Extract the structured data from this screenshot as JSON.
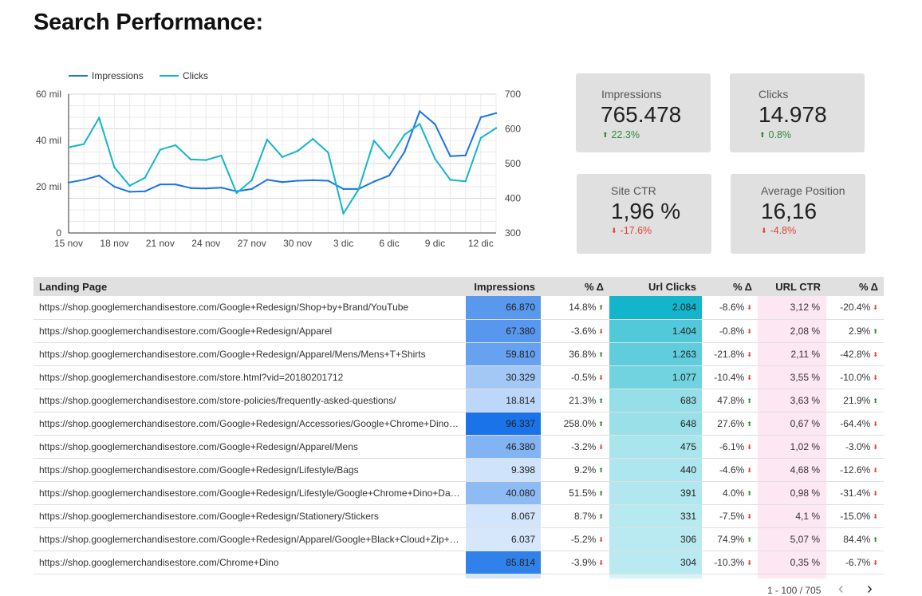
{
  "page": {
    "title": "Search Performance:"
  },
  "chart_data": {
    "type": "line",
    "x": [
      "15 nov",
      "16 nov",
      "17 nov",
      "18 nov",
      "19 nov",
      "20 nov",
      "21 nov",
      "22 nov",
      "23 nov",
      "24 nov",
      "25 nov",
      "26 nov",
      "27 nov",
      "28 nov",
      "29 nov",
      "30 nov",
      "1 dic",
      "2 dic",
      "3 dic",
      "4 dic",
      "5 dic",
      "6 dic",
      "7 dic",
      "8 dic",
      "9 dic",
      "10 dic",
      "11 dic",
      "12 dic",
      "13 dic"
    ],
    "x_ticks": [
      "15 nov",
      "18 nov",
      "21 nov",
      "24 nov",
      "27 nov",
      "30 nov",
      "3 dic",
      "6 dic",
      "9 dic",
      "12 dic"
    ],
    "series": [
      {
        "name": "Impressions",
        "axis": "left",
        "color": "#1a73e8",
        "values": [
          21800,
          23000,
          24800,
          20000,
          17800,
          18000,
          21000,
          21000,
          19400,
          19200,
          19600,
          18000,
          19000,
          23000,
          22000,
          22600,
          22800,
          22600,
          19000,
          19000,
          22200,
          24800,
          35000,
          52600,
          47000,
          33200,
          33500,
          50000,
          51800
        ]
      },
      {
        "name": "Clicks",
        "axis": "right",
        "color": "#12b5cb",
        "values": [
          547,
          556,
          632,
          489,
          436,
          459,
          540,
          553,
          512,
          510,
          523,
          415,
          452,
          569,
          519,
          536,
          571,
          532,
          356,
          426,
          566,
          515,
          583,
          614,
          514,
          453,
          449,
          574,
          602
        ]
      }
    ],
    "y_left": {
      "min": 0,
      "max": 60000,
      "ticks": [
        "0",
        "20 mil",
        "40 mil",
        "60 mil"
      ]
    },
    "y_right": {
      "min": 300,
      "max": 700,
      "ticks": [
        "300",
        "400",
        "500",
        "600",
        "700"
      ]
    },
    "grid": true,
    "legend": "top-left"
  },
  "scorecards": [
    {
      "label": "Impressions",
      "value": "765.478",
      "delta": "22.3%",
      "dir": "up"
    },
    {
      "label": "Clicks",
      "value": "14.978",
      "delta": "0.8%",
      "dir": "up"
    },
    {
      "label": "Site CTR",
      "value": "1,96 %",
      "delta": "-17.6%",
      "dir": "down"
    },
    {
      "label": "Average Position",
      "value": "16,16",
      "delta": "-4.8%",
      "dir": "down"
    }
  ],
  "table": {
    "headers": [
      "Landing Page",
      "Impressions",
      "% Δ",
      "Url Clicks",
      "% Δ",
      "URL CTR",
      "% Δ"
    ],
    "bar_colors": {
      "impressions_max": "#1a73e8",
      "impressions_min": "#e3effd",
      "clicks_max": "#12b5cb",
      "clicks_min": "#d6f3f7"
    },
    "rows": [
      {
        "url": "https://shop.googlemerchandisestore.com/Google+Redesign/Shop+by+Brand/YouTube",
        "impressions": "66.870",
        "imp_delta": "14.8%",
        "imp_dir": "up",
        "clicks": "2.084",
        "clk_delta": "-8.6%",
        "clk_dir": "down",
        "ctr": "3,12 %",
        "ctr_delta": "-20.4%",
        "ctr_dir": "down",
        "imp_level": 0.694,
        "clk_level": 1.0
      },
      {
        "url": "https://shop.googlemerchandisestore.com/Google+Redesign/Apparel",
        "impressions": "67.380",
        "imp_delta": "-3.6%",
        "imp_dir": "down",
        "clicks": "1.404",
        "clk_delta": "-0.8%",
        "clk_dir": "down",
        "ctr": "2,08 %",
        "ctr_delta": "2.9%",
        "ctr_dir": "up",
        "imp_level": 0.699,
        "clk_level": 0.674
      },
      {
        "url": "https://shop.googlemerchandisestore.com/Google+Redesign/Apparel/Mens/Mens+T+Shirts",
        "impressions": "59.810",
        "imp_delta": "36.8%",
        "imp_dir": "up",
        "clicks": "1.263",
        "clk_delta": "-21.8%",
        "clk_dir": "down",
        "ctr": "2,11 %",
        "ctr_delta": "-42.8%",
        "ctr_dir": "down",
        "imp_level": 0.621,
        "clk_level": 0.606
      },
      {
        "url": "https://shop.googlemerchandisestore.com/store.html?vid=20180201712",
        "impressions": "30.329",
        "imp_delta": "-0.5%",
        "imp_dir": "down",
        "clicks": "1.077",
        "clk_delta": "-10.4%",
        "clk_dir": "down",
        "ctr": "3,55 %",
        "ctr_delta": "-10.0%",
        "ctr_dir": "down",
        "imp_level": 0.315,
        "clk_level": 0.517
      },
      {
        "url": "https://shop.googlemerchandisestore.com/store-policies/frequently-asked-questions/",
        "impressions": "18.814",
        "imp_delta": "21.3%",
        "imp_dir": "up",
        "clicks": "683",
        "clk_delta": "47.8%",
        "clk_dir": "up",
        "ctr": "3,63 %",
        "ctr_delta": "21.9%",
        "ctr_dir": "up",
        "imp_level": 0.195,
        "clk_level": 0.328
      },
      {
        "url": "https://shop.googlemerchandisestore.com/Google+Redesign/Accessories/Google+Chrome+Dino+Collectible+Figurines",
        "impressions": "96.337",
        "imp_delta": "258.0%",
        "imp_dir": "up",
        "clicks": "648",
        "clk_delta": "27.6%",
        "clk_dir": "up",
        "ctr": "0,67 %",
        "ctr_delta": "-64.4%",
        "ctr_dir": "down",
        "imp_level": 1.0,
        "clk_level": 0.311
      },
      {
        "url": "https://shop.googlemerchandisestore.com/Google+Redesign/Apparel/Mens",
        "impressions": "46.380",
        "imp_delta": "-3.2%",
        "imp_dir": "down",
        "clicks": "475",
        "clk_delta": "-6.1%",
        "clk_dir": "down",
        "ctr": "1,02 %",
        "ctr_delta": "-3.0%",
        "ctr_dir": "down",
        "imp_level": 0.481,
        "clk_level": 0.228
      },
      {
        "url": "https://shop.googlemerchandisestore.com/Google+Redesign/Lifestyle/Bags",
        "impressions": "9.398",
        "imp_delta": "9.2%",
        "imp_dir": "up",
        "clicks": "440",
        "clk_delta": "-4.6%",
        "clk_dir": "down",
        "ctr": "4,68 %",
        "ctr_delta": "-12.6%",
        "ctr_dir": "down",
        "imp_level": 0.098,
        "clk_level": 0.211
      },
      {
        "url": "https://shop.googlemerchandisestore.com/Google+Redesign/Lifestyle/Google+Chrome+Dino+Dark+Mode+Collectible",
        "impressions": "40.080",
        "imp_delta": "51.5%",
        "imp_dir": "up",
        "clicks": "391",
        "clk_delta": "4.0%",
        "clk_dir": "up",
        "ctr": "0,98 %",
        "ctr_delta": "-31.4%",
        "ctr_dir": "down",
        "imp_level": 0.416,
        "clk_level": 0.188
      },
      {
        "url": "https://shop.googlemerchandisestore.com/Google+Redesign/Stationery/Stickers",
        "impressions": "8.067",
        "imp_delta": "8.7%",
        "imp_dir": "up",
        "clicks": "331",
        "clk_delta": "-7.5%",
        "clk_dir": "down",
        "ctr": "4,1 %",
        "ctr_delta": "-15.0%",
        "ctr_dir": "down",
        "imp_level": 0.084,
        "clk_level": 0.159
      },
      {
        "url": "https://shop.googlemerchandisestore.com/Google+Redesign/Apparel/Google+Black+Cloud+Zip+Hoodie",
        "impressions": "6.037",
        "imp_delta": "-5.2%",
        "imp_dir": "down",
        "clicks": "306",
        "clk_delta": "74.9%",
        "clk_dir": "up",
        "ctr": "5,07 %",
        "ctr_delta": "84.4%",
        "ctr_dir": "up",
        "imp_level": 0.063,
        "clk_level": 0.147
      },
      {
        "url": "https://shop.googlemerchandisestore.com/Chrome+Dino",
        "impressions": "85.814",
        "imp_delta": "-3.9%",
        "imp_dir": "down",
        "clicks": "304",
        "clk_delta": "-10.3%",
        "clk_dir": "down",
        "ctr": "0,35 %",
        "ctr_delta": "-6.7%",
        "ctr_dir": "down",
        "imp_level": 0.891,
        "clk_level": 0.146
      }
    ]
  },
  "pagination": {
    "text": "1 - 100 / 705",
    "prev": "‹",
    "next": "›"
  },
  "icons": {
    "up": "arrow-up-icon",
    "down": "arrow-down-icon"
  },
  "colors": {
    "up": "#2e8b3a",
    "down": "#e0443e",
    "ctr_bg": "#fde7f2",
    "card_bg": "#e0e0e0"
  }
}
